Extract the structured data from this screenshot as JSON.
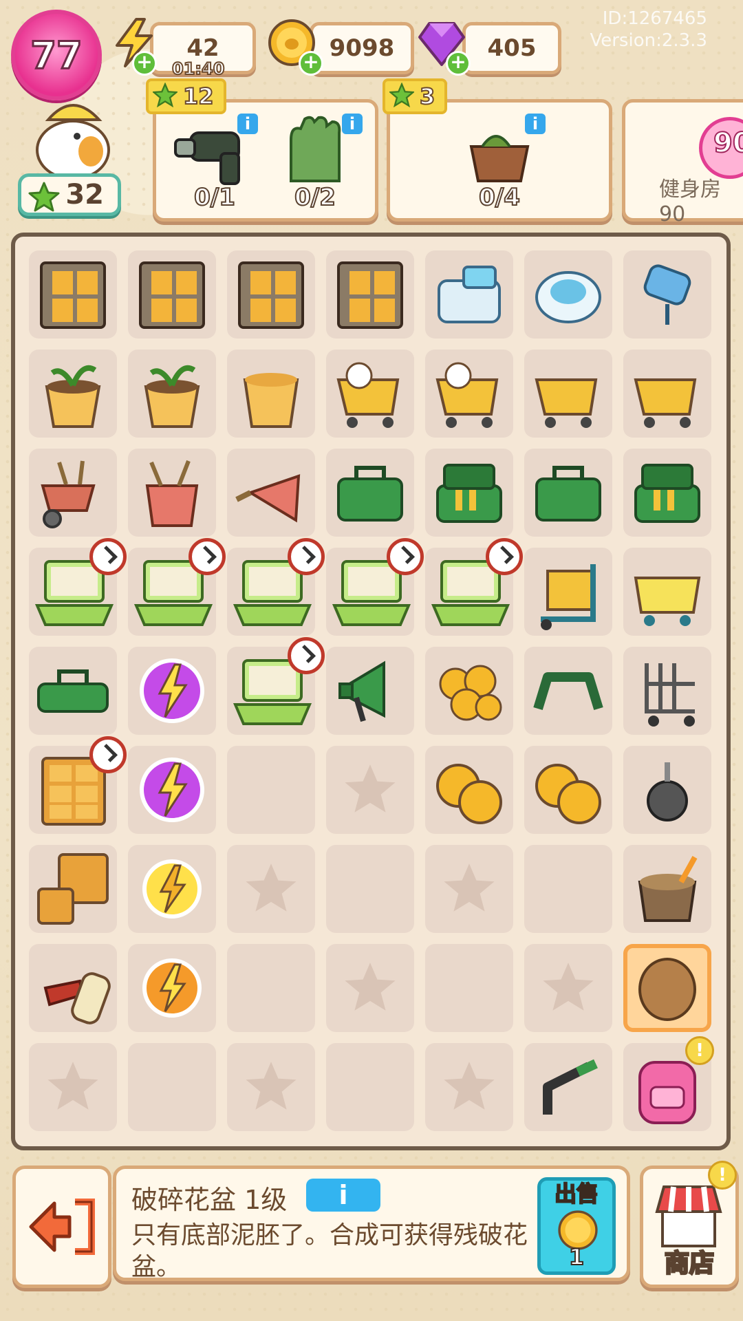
{
  "player": {
    "level": "77",
    "id_text": "ID:1267465",
    "version_text": "Version:2.3.3",
    "stars": "32"
  },
  "resources": {
    "energy": "42",
    "energy_timer": "01:40",
    "coins": "9098",
    "gems": "405"
  },
  "orders": [
    {
      "stars": "12",
      "items": [
        {
          "name": "electric-drill",
          "progress": "0/1"
        },
        {
          "name": "work-glove",
          "progress": "0/2"
        }
      ]
    },
    {
      "stars": "3",
      "items": [
        {
          "name": "broken-flower-pot",
          "progress": "0/4"
        }
      ]
    },
    {
      "badge": "90",
      "label": "健身房90"
    }
  ],
  "board": {
    "rows": [
      [
        "locker",
        "locker",
        "locker",
        "locker",
        "robot-vacuum-dock",
        "robot-vacuum",
        "paint-roller"
      ],
      [
        "plant-pot",
        "plant-pot",
        "empty-pot",
        "shopping-cart-duck",
        "shopping-cart-duck",
        "shopping-cart",
        "shopping-cart"
      ],
      [
        "wheelbarrow",
        "bucket-tools",
        "trowel",
        "toolbox",
        "toolbox-open",
        "toolbox",
        "toolbox-open"
      ],
      [
        "laptop",
        "laptop",
        "laptop",
        "laptop",
        "laptop",
        "hand-truck",
        "cart-basket"
      ],
      [
        "toolbox-lid",
        "energy-orb-purple",
        "laptop",
        "megaphone",
        "coin-pile",
        "handle",
        "cart-frame"
      ],
      [
        "cabinet",
        "energy-orb-purple",
        "blank",
        "star",
        "coins-stack",
        "coins-stack",
        "caster-wheel"
      ],
      [
        "drawer-cabinet",
        "energy-orb-yellow",
        "star",
        "blank",
        "star",
        "blank",
        "broken-pot"
      ],
      [
        "key-tag",
        "energy-orb-orange",
        "blank",
        "star",
        "blank",
        "star",
        "bread-stone"
      ],
      [
        "star",
        "blank",
        "star",
        "blank",
        "star",
        "pipe",
        "backpack"
      ]
    ],
    "timer_cells": [
      "3-0",
      "3-1",
      "3-2",
      "3-3",
      "3-4",
      "4-2",
      "5-0"
    ],
    "selected_cell": "7-6"
  },
  "selected_item": {
    "name": "破碎花盆 1级",
    "description": "只有底部泥胚了。合成可获得残破花盆。",
    "sell_label": "出售",
    "sell_price": "1"
  },
  "shop": {
    "label": "商店"
  },
  "colors": {
    "panel_border": "#d9a978",
    "board_border": "#6e5b49",
    "accent_pink": "#e8308f",
    "accent_blue": "#33b4f0"
  }
}
